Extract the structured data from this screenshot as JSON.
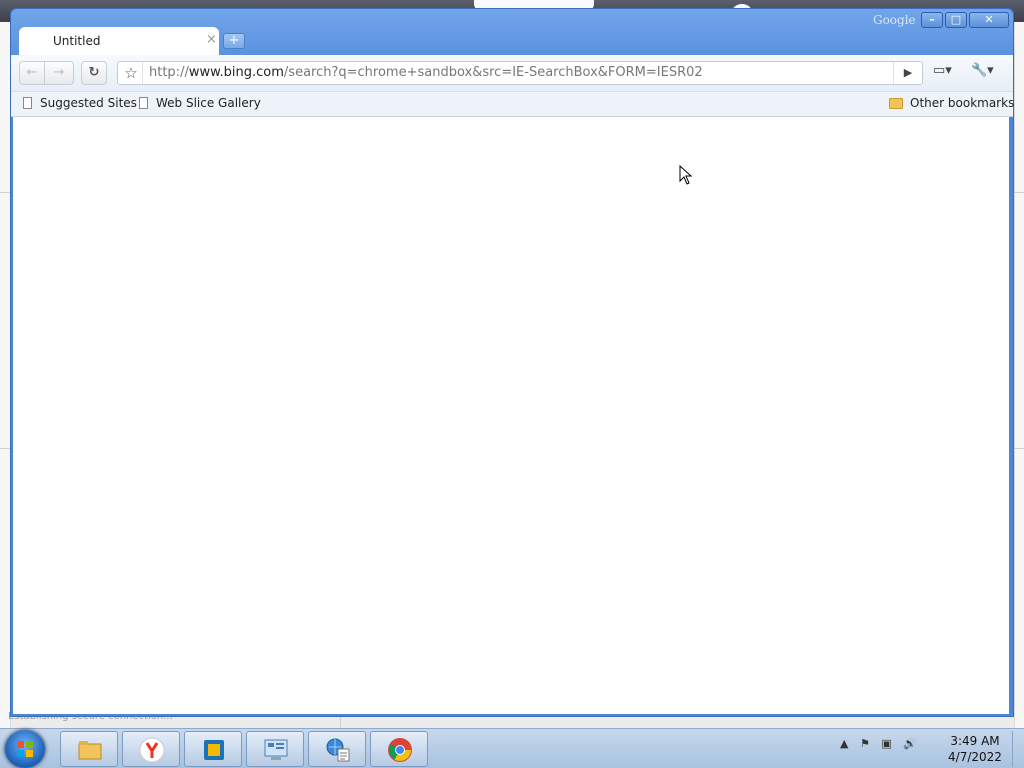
{
  "browser": {
    "brand": "Google",
    "tab_title": "Untitled",
    "tab_close": "×",
    "new_tab": "+",
    "window_buttons": {
      "minimize": "–",
      "maximize": "□",
      "close": "✕"
    },
    "nav": {
      "back": "←",
      "forward": "→",
      "reload": "↻",
      "star": "☆",
      "go": "▶",
      "page_menu": "▭▾",
      "tools_menu": "🔧▾"
    },
    "url": {
      "scheme": "http://",
      "host": "www.bing.com",
      "path": "/search?q=chrome+sandbox&src=IE-SearchBox&FORM=IESR02"
    },
    "bookmarks": {
      "items": [
        {
          "label": "Suggested Sites"
        },
        {
          "label": "Web Slice Gallery"
        }
      ],
      "other": "Other bookmarks"
    }
  },
  "desktop": {
    "status_text": "Establishing secure connection..."
  },
  "taskbar": {
    "apps": [
      "file-explorer",
      "yandex-browser",
      "virtualbox",
      "control-panel",
      "internet-explorer",
      "chrome"
    ],
    "tray_icons": [
      "show-hidden-icons",
      "action-center",
      "network",
      "volume"
    ],
    "time": "3:49 AM",
    "date": "4/7/2022"
  }
}
